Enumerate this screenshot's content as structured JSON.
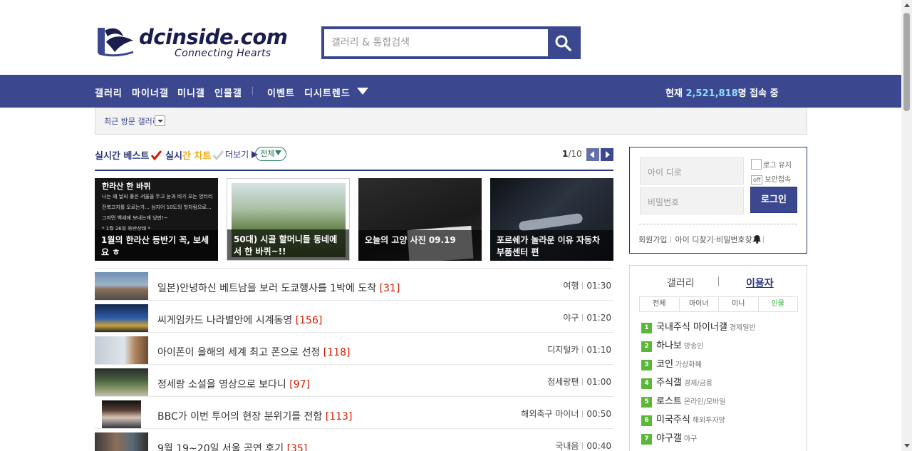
{
  "header": {
    "brand": "dcinside.com",
    "tagline": "Connecting Hearts",
    "search_placeholder": "갤러리 & 통합검색"
  },
  "nav": {
    "items": [
      "갤러리",
      "마이너갤",
      "미니갤",
      "인물갤",
      "이벤트",
      "디시트렌드"
    ],
    "users_prefix": "현재",
    "users_count": "2,521,818",
    "users_suffix": "명 접속 중"
  },
  "gallery_bar": {
    "label": "최근 방문 갤러리"
  },
  "content_tabs": {
    "tab1": "실시간 베스트",
    "tab2_prefix": "실시",
    "tab2_highlight": "간 차트",
    "tab3": "더보기",
    "pill": "전체",
    "page_current": "1",
    "page_total": "/10"
  },
  "featured": [
    {
      "caption": "1월의 한라산 등반기 꼭, 보세요 ㅎ",
      "overlay_title": "한라산 한 바퀴",
      "overlay_lines": [
        "나는 왜 날씨 좋은 서울을 두고 눈과 비가 오는 엉터리",
        "전북고지를 오르는가... 심지어 10도의 찻차림으로...",
        "그저먼 백세에 보내는게 낭만!~",
        "",
        "* 1월 26일 등반상태 *"
      ]
    },
    {
      "caption": "50대) 시골 할머니들 동네에서 한 바퀴~!!"
    },
    {
      "caption": "오늘의 고양 사진 09.19"
    },
    {
      "caption": "포르쉐가 놀라운 이유 자동차부품센터 편"
    }
  ],
  "articles": [
    {
      "title": "일본)안녕하신 베트남을 보러 도쿄행사를 1박에 도착",
      "count": "[31]",
      "author": "여행",
      "time": "01:30"
    },
    {
      "title": "씨게임카드 나라별안에 시계동영",
      "count": "[156]",
      "author": "야구",
      "time": "01:20"
    },
    {
      "title": "아이폰이 올해의 세계 최고 폰으로 선정",
      "count": "[118]",
      "author": "디지털카",
      "time": "01:10"
    },
    {
      "title": "정세랑 소설을 영상으로 보다니",
      "count": "[97]",
      "author": "정세랑팬",
      "time": "01:00"
    },
    {
      "title": "BBC가 이번 투어의 현장 분위기를 전함",
      "count": "[113]",
      "author": "해외축구 마이너",
      "time": "00:50"
    },
    {
      "title": "9월 19~20일 서울 공연 후기",
      "count": "[35]",
      "author": "국내음",
      "time": "00:40"
    }
  ],
  "login": {
    "id_placeholder": "아이 디로",
    "pw_placeholder": "비밀번호",
    "keep_label": "로그 유지",
    "secure_label": "보안접속",
    "off_label": "off",
    "button": "로그인",
    "links": [
      "회원가입",
      "아이 디찾기·비밀번호찾기"
    ]
  },
  "ranking": {
    "tab_a": "갤러리",
    "tab_b": "이용자",
    "subtabs": [
      "전체",
      "마이너",
      "미니",
      "인물"
    ],
    "items": [
      {
        "rank": "1",
        "name": "국내주식 마이너갤",
        "sub": "경제일반"
      },
      {
        "rank": "2",
        "name": "하나보",
        "sub": "방송인"
      },
      {
        "rank": "3",
        "name": "코인",
        "sub": "가상화폐"
      },
      {
        "rank": "4",
        "name": "주식갤",
        "sub": "경제/금융"
      },
      {
        "rank": "5",
        "name": "로스트",
        "sub": "온라인/모바일"
      },
      {
        "rank": "6",
        "name": "미국주식",
        "sub": "해외투자방"
      },
      {
        "rank": "7",
        "name": "야구갤",
        "sub": "야구"
      }
    ]
  },
  "colors": {
    "primary": "#3b4890",
    "accent_count": "#d31900",
    "rank_green": "#5ab738",
    "users_highlight": "#8ee0ff"
  }
}
